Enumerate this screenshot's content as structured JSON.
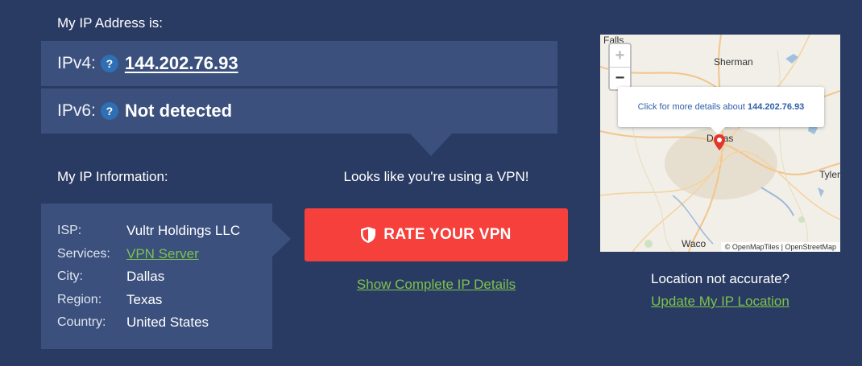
{
  "ip_section": {
    "heading": "My IP Address is:",
    "ipv4_label": "IPv4:",
    "ipv4_value": "144.202.76.93",
    "ipv6_label": "IPv6:",
    "ipv6_value": "Not detected",
    "help_glyph": "?"
  },
  "info_section": {
    "heading": "My IP Information:",
    "rows": [
      {
        "key": "ISP:",
        "value": "Vultr Holdings LLC"
      },
      {
        "key": "Services:",
        "value": "VPN Server"
      },
      {
        "key": "City:",
        "value": "Dallas"
      },
      {
        "key": "Region:",
        "value": "Texas"
      },
      {
        "key": "Country:",
        "value": "United States"
      }
    ]
  },
  "vpn": {
    "note": "Looks like you're using a VPN!",
    "button_label": "RATE YOUR VPN",
    "details_link": "Show Complete IP Details"
  },
  "map": {
    "places": [
      "Falls",
      "Sherman",
      "Dallas",
      "Tyler",
      "Waco"
    ],
    "zoom_in": "+",
    "zoom_out": "−",
    "popup_prefix": "Click for more details about",
    "popup_ip": "144.202.76.93",
    "attribution": "© OpenMapTiles | OpenStreetMap",
    "marker_icon": "map-pin-icon"
  },
  "location": {
    "question": "Location not accurate?",
    "update_link": "Update My IP Location"
  },
  "colors": {
    "background": "#2a3b63",
    "panel": "#3b507d",
    "button": "#f5403b",
    "link": "#7cc24c",
    "help_icon": "#2f6fb4"
  }
}
